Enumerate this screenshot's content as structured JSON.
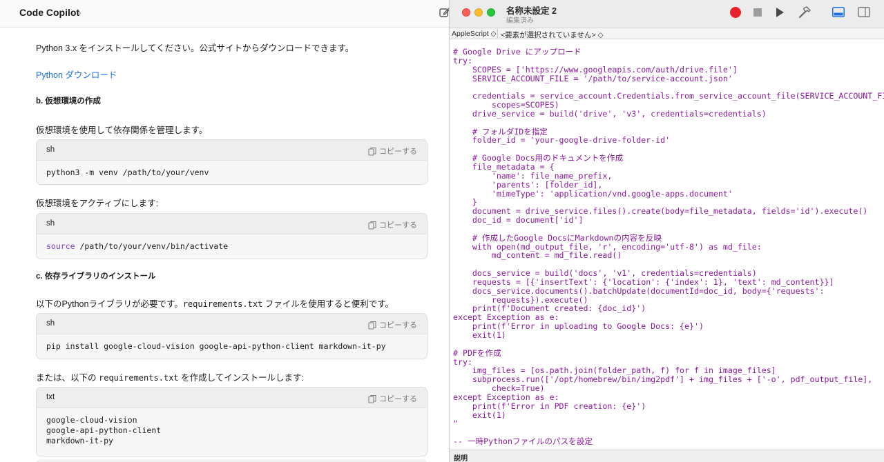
{
  "chat": {
    "app_title": "Code Copilot",
    "app_title_chevron": "›",
    "paragraphs": {
      "install_python": "Python 3.x をインストールしてください。公式サイトからダウンロードできます。",
      "python_link": "Python ダウンロード",
      "venv_heading": "b. 仮想環境の作成",
      "venv_desc": "仮想環境を使用して依存関係を管理します。",
      "activate_desc": "仮想環境をアクティブにします:",
      "libs_heading": "c. 依存ライブラリのインストール",
      "libs_desc_pre": "以下の",
      "libs_desc_python": "Python",
      "libs_desc_mid": "ライブラリが必要です。",
      "libs_desc_file": "requirements.txt",
      "libs_desc_post": "ファイルを使用すると便利です。",
      "or_desc_pre": "または、以下の",
      "or_desc_file": "requirements.txt",
      "or_desc_post": "を作成してインストールします:"
    },
    "copy_label": "コピーする",
    "code_blocks": [
      {
        "lang": "sh",
        "lines": [
          "python3 -m venv /path/to/your/venv"
        ]
      },
      {
        "lang": "sh",
        "keyword": "source",
        "rest": " /path/to/your/venv/bin/activate"
      },
      {
        "lang": "sh",
        "lines": [
          "pip install google-cloud-vision google-api-python-client markdown-it-py"
        ]
      },
      {
        "lang": "txt",
        "lines": [
          "google-cloud-vision",
          "google-api-python-client",
          "markdown-it-py"
        ]
      }
    ]
  },
  "editor": {
    "title": "名称未設定 2",
    "subtitle": "編集済み",
    "nav_language": "AppleScript ◇",
    "nav_element": "<要素が選択されていません> ◇",
    "footer_label": "説明",
    "code_lines": [
      "# Google Drive にアップロード",
      "try:",
      "    SCOPES = ['https://www.googleapis.com/auth/drive.file']",
      "    SERVICE_ACCOUNT_FILE = '/path/to/service-account.json'",
      "",
      "    credentials = service_account.Credentials.from_service_account_file(SERVICE_ACCOUNT_FILE,",
      "        scopes=SCOPES)",
      "    drive_service = build('drive', 'v3', credentials=credentials)",
      "",
      "    # フォルダIDを指定",
      "    folder_id = 'your-google-drive-folder-id'",
      "",
      "    # Google Docs用のドキュメントを作成",
      "    file_metadata = {",
      "        'name': file_name_prefix,",
      "        'parents': [folder_id],",
      "        'mimeType': 'application/vnd.google-apps.document'",
      "    }",
      "    document = drive_service.files().create(body=file_metadata, fields='id').execute()",
      "    doc_id = document['id']",
      "",
      "    # 作成したGoogle DocsにMarkdownの内容を反映",
      "    with open(md_output_file, 'r', encoding='utf-8') as md_file:",
      "        md_content = md_file.read()",
      "",
      "    docs_service = build('docs', 'v1', credentials=credentials)",
      "    requests = [{'insertText': {'location': {'index': 1}, 'text': md_content}}]",
      "    docs_service.documents().batchUpdate(documentId=doc_id, body={'requests':",
      "        requests}).execute()",
      "    print(f'Document created: {doc_id}')",
      "except Exception as e:",
      "    print(f'Error in uploading to Google Docs: {e}')",
      "    exit(1)",
      "",
      "# PDFを作成",
      "try:",
      "    img_files = [os.path.join(folder_path, f) for f in image_files]",
      "    subprocess.run(['/opt/homebrew/bin/img2pdf'] + img_files + ['-o', pdf_output_file],",
      "        check=True)",
      "except Exception as e:",
      "    print(f'Error in PDF creation: {e}')",
      "    exit(1)",
      "\"",
      "",
      "-- 一時Pythonファイルのパスを設定"
    ]
  },
  "colors": {
    "code_purple": "#8a1a9c",
    "link_blue": "#1a6fd6",
    "record_red": "#e7242b"
  },
  "icons": {
    "edit": "compose-icon",
    "copy": "copy-icon",
    "hammer": "hammer-icon"
  }
}
